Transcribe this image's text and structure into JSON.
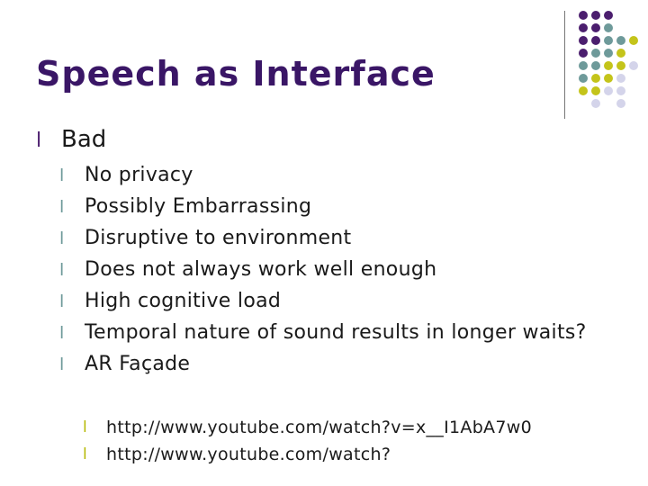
{
  "slide": {
    "title": "Speech as Interface",
    "bullet_glyph": "l",
    "level1": {
      "label": "Bad"
    },
    "level2": [
      "No privacy",
      "Possibly Embarrassing",
      "Disruptive to environment",
      "Does not always work well enough",
      "High cognitive load",
      "Temporal nature of sound results in longer waits?",
      "AR Façade"
    ],
    "level3": [
      "http://www.youtube.com/watch?v=x__I1AbA7w0",
      "http://www.youtube.com/watch?"
    ]
  },
  "colors": {
    "title": "#3a1666",
    "dot_purple": "#4b1e6e",
    "dot_teal": "#6e9a9a",
    "dot_yellow": "#c4c41a",
    "dot_lavender": "#d4d4ea"
  },
  "decor": {
    "dot_grid": [
      [
        "purple",
        "purple",
        "purple",
        null,
        null
      ],
      [
        "purple",
        "purple",
        "teal",
        null,
        null
      ],
      [
        "purple",
        "purple",
        "teal",
        "teal",
        "yellow"
      ],
      [
        "purple",
        "teal",
        "teal",
        "yellow",
        null
      ],
      [
        "teal",
        "teal",
        "yellow",
        "yellow",
        "lavender"
      ],
      [
        "teal",
        "yellow",
        "yellow",
        "lavender",
        null
      ],
      [
        "yellow",
        "yellow",
        "lavender",
        "lavender",
        null
      ],
      [
        null,
        "lavender",
        null,
        "lavender",
        null
      ]
    ]
  }
}
